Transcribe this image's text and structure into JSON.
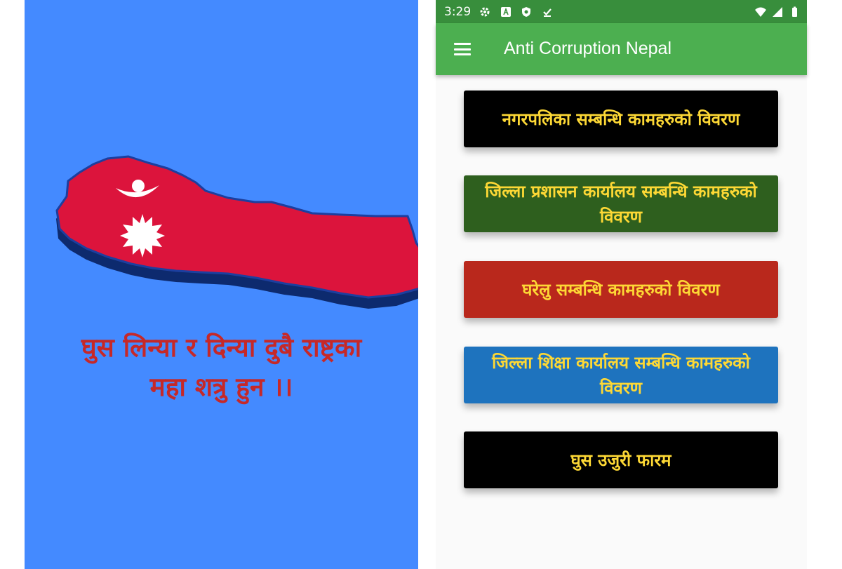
{
  "splash": {
    "background": "#448aff",
    "slogan_line1": "घुस लिन्या र दिन्या दुबै राष्ट्रका",
    "slogan_line2": "महा शत्रु हुन ।।",
    "slogan_color": "#c62828"
  },
  "status_bar": {
    "time": "3:29",
    "left_icons": [
      "settings-icon",
      "a-box-icon",
      "shield-icon",
      "download-done-icon"
    ],
    "right_icons": [
      "wifi-icon",
      "signal-icon",
      "battery-icon"
    ]
  },
  "app_bar": {
    "title": "Anti Corruption Nepal",
    "color": "#4caf50",
    "menu_icon": "hamburger-menu-icon"
  },
  "buttons": [
    {
      "label": "नगरपलिका सम्बन्धि कामहरुको विवरण",
      "color": "#000000"
    },
    {
      "label": "जिल्ला प्रशासन कार्यालय सम्बन्धि कामहरुको विवरण",
      "color": "#2e5f1e"
    },
    {
      "label": "घरेलु सम्बन्धि कामहरुको विवरण",
      "color": "#b9281c"
    },
    {
      "label": "जिल्ला शिक्षा कार्यालय सम्बन्धि कामहरुको विवरण",
      "color": "#1e73be"
    },
    {
      "label": "घुस उजुरी फारम",
      "color": "#000000"
    }
  ]
}
